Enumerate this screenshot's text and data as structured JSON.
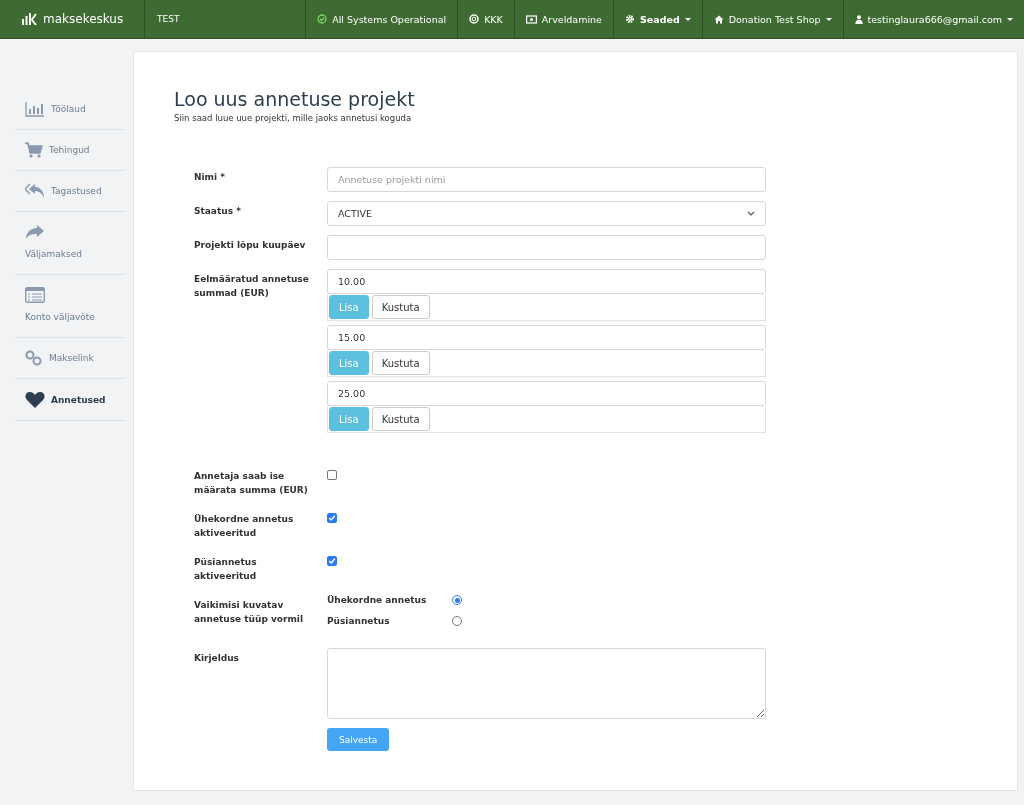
{
  "topbar": {
    "logo": "maksekeskus",
    "environment": "TEST",
    "items": [
      {
        "label": "All Systems Operational",
        "kind": "status",
        "dropdown": false
      },
      {
        "label": "KKK",
        "kind": "help",
        "dropdown": false
      },
      {
        "label": "Arveldamine",
        "kind": "billing",
        "dropdown": false
      },
      {
        "label": "Seaded",
        "kind": "settings",
        "dropdown": true
      },
      {
        "label": "Donation Test Shop",
        "kind": "shop",
        "dropdown": true
      },
      {
        "label": "testinglaura666@gmail.com",
        "kind": "user",
        "dropdown": true
      }
    ]
  },
  "sidebar": {
    "items": [
      {
        "label": "Töölaud",
        "kind": "chart",
        "selected": false
      },
      {
        "label": "Tehingud",
        "kind": "cart",
        "selected": false
      },
      {
        "label": "Tagastused",
        "kind": "reply",
        "selected": false
      },
      {
        "label": "Väljamaksed",
        "kind": "forward",
        "selected": false
      },
      {
        "label": "Konto väljavõte",
        "kind": "list",
        "selected": false
      },
      {
        "label": "Makselink",
        "kind": "link",
        "selected": false
      },
      {
        "label": "Annetused",
        "kind": "heart",
        "selected": true
      }
    ]
  },
  "page": {
    "title": "Loo uus annetuse projekt",
    "subtitle": "Siin saad luue uue projekti, mille jaoks annetusi koguda"
  },
  "form": {
    "name": {
      "label": "Nimi *",
      "placeholder": "Annetuse projekti nimi"
    },
    "status": {
      "label": "Staatus *",
      "value": "ACTIVE"
    },
    "end_date": {
      "label": "Projekti lõpu kuupäev"
    },
    "amounts": {
      "label": "Eelmääratud annetuse summad (EUR)",
      "items": [
        {
          "value": "10.00",
          "add": "Lisa",
          "delete": "Kustuta"
        },
        {
          "value": "15.00",
          "add": "Lisa",
          "delete": "Kustuta"
        },
        {
          "value": "25.00",
          "add": "Lisa",
          "delete": "Kustuta"
        }
      ]
    },
    "checkboxes": [
      {
        "label": "Annetaja saab ise määrata summa (EUR)",
        "checked": false
      },
      {
        "label": "Ühekordne annetus aktiveeritud",
        "checked": true
      },
      {
        "label": "Püsiannetus aktiveeritud",
        "checked": true
      }
    ],
    "default_type": {
      "label": "Vaikimisi kuvatav annetuse tüüp vormil",
      "options": [
        {
          "label": "Ühekordne annetus",
          "selected": true
        },
        {
          "label": "Püsiannetus",
          "selected": false
        }
      ]
    },
    "description": {
      "label": "Kirjeldus"
    },
    "submit": "Salvesta"
  }
}
